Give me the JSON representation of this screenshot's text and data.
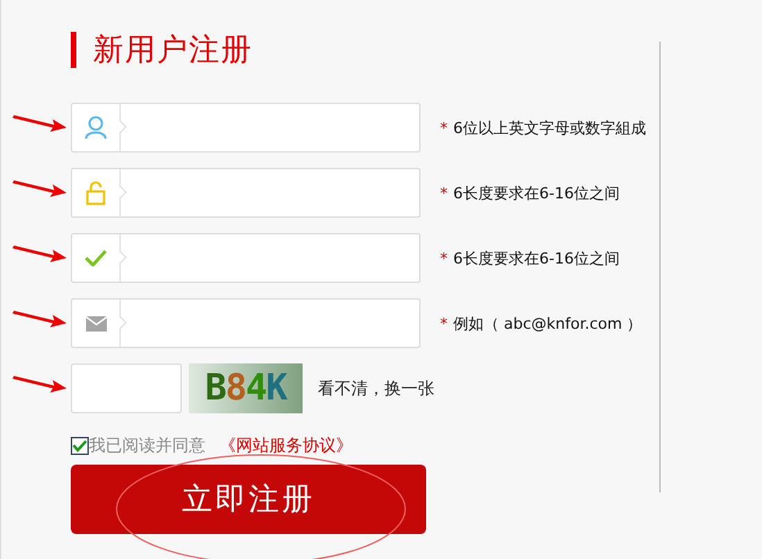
{
  "title": "新用户注册",
  "fields": [
    {
      "kind": "user",
      "required_mark": "*",
      "hint": "6位以上英文字母或数字組成",
      "annotated": true
    },
    {
      "kind": "lock",
      "required_mark": "*",
      "hint": "6长度要求在6-16位之间",
      "annotated": true
    },
    {
      "kind": "check",
      "required_mark": "*",
      "hint": "6长度要求在6-16位之间",
      "annotated": true
    },
    {
      "kind": "mail",
      "required_mark": "*",
      "hint": "例如（ abc@knfor.com ）",
      "annotated": true
    }
  ],
  "captcha": {
    "code": "B84K",
    "refresh": "看不清，换一张",
    "annotated": true
  },
  "agreement": {
    "checked": true,
    "text": "我已阅读并同意",
    "link": "《网站服务协议》"
  },
  "submit": {
    "label": "立即注册",
    "circled": true
  }
}
